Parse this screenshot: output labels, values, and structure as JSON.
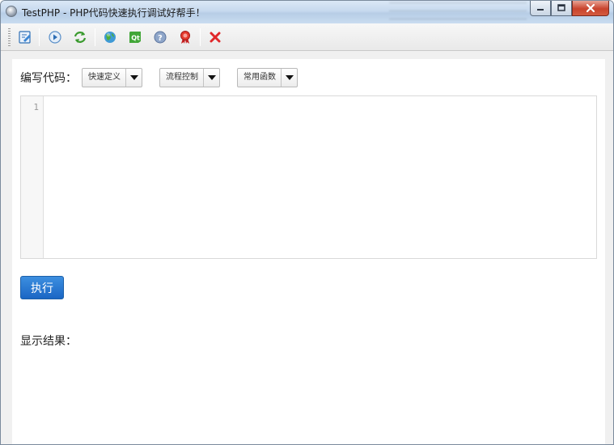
{
  "window": {
    "title": "TestPHP - PHP代码快速执行调试好帮手！"
  },
  "toolbar": {
    "buttons": [
      {
        "icon": "edit-script-icon"
      },
      {
        "icon": "play-icon"
      },
      {
        "icon": "refresh-icon"
      },
      {
        "icon": "globe-icon"
      },
      {
        "icon": "qt-icon"
      },
      {
        "icon": "help-icon"
      },
      {
        "icon": "award-icon"
      },
      {
        "icon": "close-x-icon"
      }
    ]
  },
  "editor_section": {
    "label": "编写代码：",
    "dropdowns": [
      {
        "label": "快速定义"
      },
      {
        "label": "流程控制"
      },
      {
        "label": "常用函数"
      }
    ],
    "line_number": "1",
    "code": ""
  },
  "execute_button": {
    "label": "执行"
  },
  "result_section": {
    "label": "显示结果："
  },
  "colors": {
    "accent": "#1a66c4",
    "close_icon": "#e0282a"
  }
}
